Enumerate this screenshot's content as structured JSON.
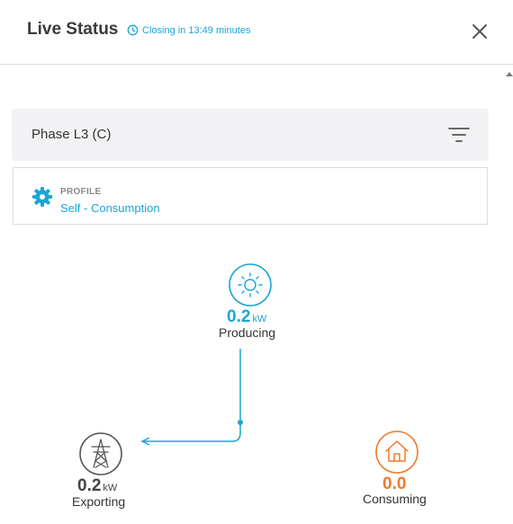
{
  "header": {
    "title": "Live Status",
    "closing_text": "Closing in 13:49 minutes"
  },
  "phase": {
    "label": "Phase L3 (C)"
  },
  "profile": {
    "heading": "PROFILE",
    "value": "Self - Consumption"
  },
  "flow": {
    "producing": {
      "value": "0.2",
      "unit": "kW",
      "label": "Producing",
      "icon": "sun-icon",
      "color": "#1aa6d6"
    },
    "exporting": {
      "value": "0.2",
      "unit": "kW",
      "label": "Exporting",
      "icon": "grid-tower-icon",
      "color": "#444444"
    },
    "consuming": {
      "value": "0.0",
      "label": "Consuming",
      "icon": "home-icon",
      "color": "#f07a2a"
    }
  },
  "colors": {
    "accent": "#1aa6d6",
    "consume": "#f07a2a"
  }
}
